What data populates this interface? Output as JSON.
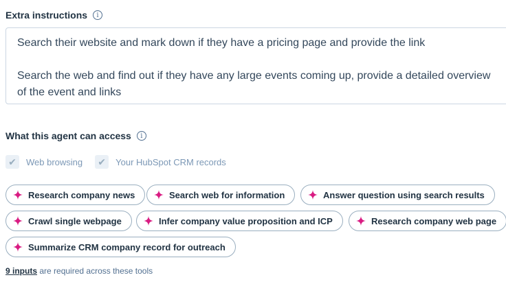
{
  "extra_instructions": {
    "label": "Extra instructions",
    "info_icon": "info-icon",
    "value": "Search their website and mark down if they have a pricing page and provide the link\n\nSearch the web and find out if they have any large events coming up, provide a detailed overview of the event and links"
  },
  "access": {
    "label": "What this agent can access",
    "info_icon": "info-icon",
    "checkboxes": [
      {
        "label": "Web browsing",
        "checked": true
      },
      {
        "label": "Your HubSpot CRM records",
        "checked": true
      }
    ]
  },
  "tools": [
    {
      "label": "Research company news",
      "icon": "sparkle-icon"
    },
    {
      "label": "Search web for information",
      "icon": "sparkle-icon"
    },
    {
      "label": "Answer question using search results",
      "icon": "sparkle-icon"
    },
    {
      "label": "Crawl single webpage",
      "icon": "sparkle-icon"
    },
    {
      "label": "Infer company value proposition and ICP",
      "icon": "sparkle-icon"
    },
    {
      "label": "Research company web page",
      "icon": "sparkle-icon"
    },
    {
      "label": "Summarize CRM company record for outreach",
      "icon": "sparkle-icon"
    }
  ],
  "footer": {
    "inputs_link": "9 inputs",
    "text": "are required across these tools"
  },
  "colors": {
    "sparkle": "#d91b82",
    "text": "#33475b",
    "border": "#cbd6e2"
  }
}
